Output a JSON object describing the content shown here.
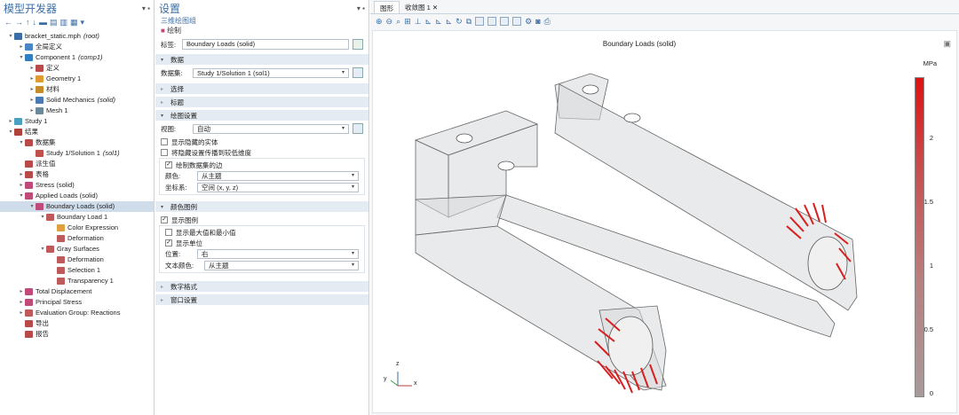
{
  "builder": {
    "title": "模型开发器",
    "pin": "▾ ▪",
    "tree": [
      {
        "label": "bracket_static.mph",
        "em": "(root)",
        "level": 0,
        "tw": "▾",
        "color": "#3a6ea5"
      },
      {
        "label": "全局定义",
        "em": "",
        "level": 1,
        "tw": "▸",
        "color": "#4a86c5"
      },
      {
        "label": "Component 1",
        "em": "(comp1)",
        "level": 1,
        "tw": "▾",
        "color": "#2f7fc2"
      },
      {
        "label": "定义",
        "em": "",
        "level": 2,
        "tw": "▸",
        "color": "#b94a4a"
      },
      {
        "label": "Geometry 1",
        "em": "",
        "level": 2,
        "tw": "▸",
        "color": "#e09a30"
      },
      {
        "label": "材料",
        "em": "",
        "level": 2,
        "tw": "▸",
        "color": "#c58a2a"
      },
      {
        "label": "Solid Mechanics",
        "em": "(solid)",
        "level": 2,
        "tw": "▸",
        "color": "#4a7ab5"
      },
      {
        "label": "Mesh 1",
        "em": "",
        "level": 2,
        "tw": "▸",
        "color": "#6a8a9a"
      },
      {
        "label": "Study 1",
        "em": "",
        "level": 0,
        "tw": "▸",
        "color": "#4aa0c0"
      },
      {
        "label": "结果",
        "em": "",
        "level": 0,
        "tw": "▾",
        "color": "#b0403a"
      },
      {
        "label": "数据集",
        "em": "",
        "level": 1,
        "tw": "▾",
        "color": "#b94a4a"
      },
      {
        "label": "Study 1/Solution 1",
        "em": "(sol1)",
        "level": 2,
        "tw": "",
        "color": "#c0504a"
      },
      {
        "label": "派生值",
        "em": "",
        "level": 1,
        "tw": "",
        "color": "#b94a4a"
      },
      {
        "label": "表格",
        "em": "",
        "level": 1,
        "tw": "▸",
        "color": "#b94a4a"
      },
      {
        "label": "Stress (solid)",
        "em": "",
        "level": 1,
        "tw": "▸",
        "color": "#c04a7a"
      },
      {
        "label": "Applied Loads (solid)",
        "em": "",
        "level": 1,
        "tw": "▾",
        "color": "#c04a7a"
      },
      {
        "label": "Boundary Loads (solid)",
        "em": "",
        "level": 2,
        "tw": "▾",
        "color": "#c04a7a",
        "sel": true
      },
      {
        "label": "Boundary Load 1",
        "em": "",
        "level": 3,
        "tw": "▾",
        "color": "#c05a5a"
      },
      {
        "label": "Color Expression",
        "em": "",
        "level": 4,
        "tw": "",
        "color": "#e0a040"
      },
      {
        "label": "Deformation",
        "em": "",
        "level": 4,
        "tw": "",
        "color": "#c05a5a"
      },
      {
        "label": "Gray Surfaces",
        "em": "",
        "level": 3,
        "tw": "▾",
        "color": "#c05a5a"
      },
      {
        "label": "Deformation",
        "em": "",
        "level": 4,
        "tw": "",
        "color": "#c05a5a"
      },
      {
        "label": "Selection 1",
        "em": "",
        "level": 4,
        "tw": "",
        "color": "#c05a5a"
      },
      {
        "label": "Transparency 1",
        "em": "",
        "level": 4,
        "tw": "",
        "color": "#c05a5a"
      },
      {
        "label": "Total Displacement",
        "em": "",
        "level": 1,
        "tw": "▸",
        "color": "#c04a7a"
      },
      {
        "label": "Principal Stress",
        "em": "",
        "level": 1,
        "tw": "▸",
        "color": "#c04a7a"
      },
      {
        "label": "Evaluation Group: Reactions",
        "em": "",
        "level": 1,
        "tw": "▸",
        "color": "#c05a5a"
      },
      {
        "label": "导出",
        "em": "",
        "level": 1,
        "tw": "",
        "color": "#b94a4a"
      },
      {
        "label": "报告",
        "em": "",
        "level": 1,
        "tw": "",
        "color": "#b94a4a"
      }
    ]
  },
  "settings": {
    "title": "设置",
    "subtitle": "三维绘图组",
    "plot_label": "绘制",
    "label_key": "标签:",
    "label_value": "Boundary Loads (solid)",
    "sec_data": "数据",
    "dataset_key": "数据集:",
    "dataset_value": "Study 1/Solution 1 (sol1)",
    "sec_select": "选择",
    "sec_title": "标题",
    "sec_plot": "绘图设置",
    "view_key": "视图:",
    "view_value": "自动",
    "chk_hidden": "显示隐藏的实体",
    "chk_propagate": "将隐藏设置传播到较低维度",
    "chk_edges": "绘制数据集的边",
    "color_key": "颜色:",
    "color_value": "从主题",
    "frame_key": "坐标系:",
    "frame_value": "空间 (x, y, z)",
    "sec_legend": "颜色图例",
    "chk_legend": "显示图例",
    "chk_maxmin": "显示最大值和最小值",
    "chk_units": "显示单位",
    "pos_key": "位置:",
    "pos_value": "右",
    "textcolor_key": "文本颜色:",
    "textcolor_value": "从主题",
    "sec_number": "数字格式",
    "sec_window": "窗口设置"
  },
  "graphics": {
    "tab1": "图形",
    "tab2": "收敛图 1",
    "plot_title": "Boundary Loads (solid)",
    "unit": "MPa",
    "ticks": [
      "2",
      "1.5",
      "1",
      "0.5",
      "0"
    ],
    "axis_x": "x",
    "axis_y": "y",
    "axis_z": "z"
  }
}
